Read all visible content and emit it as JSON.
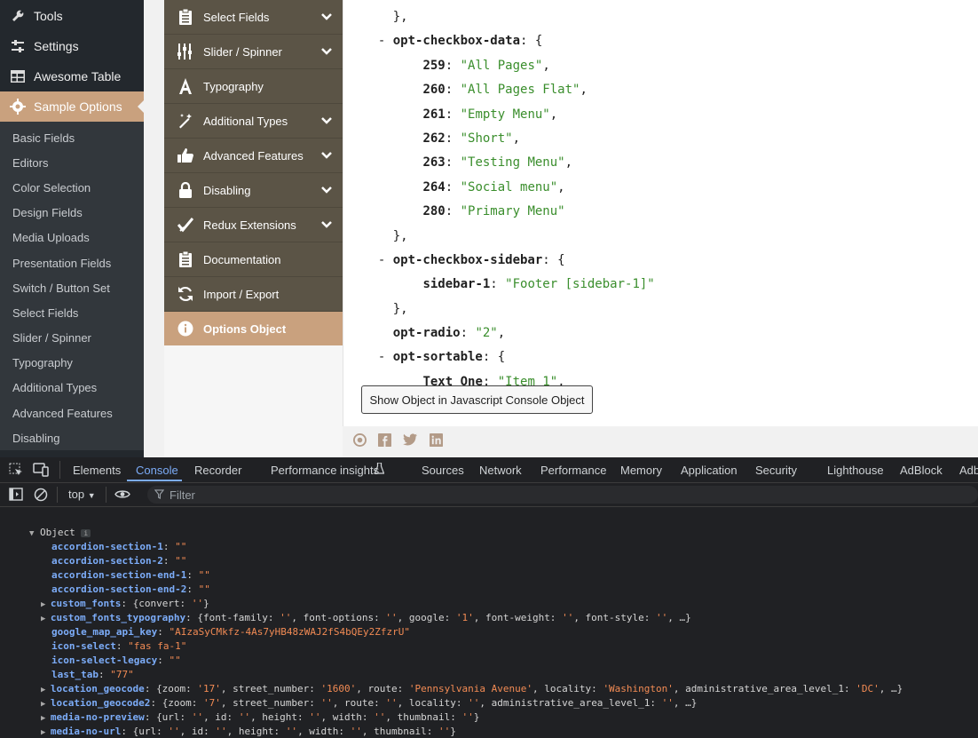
{
  "wp_sidebar": {
    "top_items": [
      {
        "label": "Tools",
        "icon": "wrench-icon"
      },
      {
        "label": "Settings",
        "icon": "sliders-icon"
      },
      {
        "label": "Awesome Table",
        "icon": "table-icon"
      },
      {
        "label": "Sample Options",
        "icon": "gear-icon"
      }
    ],
    "sub_items": [
      "Basic Fields",
      "Editors",
      "Color Selection",
      "Design Fields",
      "Media Uploads",
      "Presentation Fields",
      "Switch / Button Set",
      "Select Fields",
      "Slider / Spinner",
      "Typography",
      "Additional Types",
      "Advanced Features",
      "Disabling"
    ]
  },
  "redux_nav": {
    "items": [
      {
        "label": "Select Fields",
        "icon": "clipboard-icon",
        "chevron": true
      },
      {
        "label": "Slider / Spinner",
        "icon": "sliders-icon",
        "chevron": true
      },
      {
        "label": "Typography",
        "icon": "font-icon",
        "chevron": false
      },
      {
        "label": "Additional Types",
        "icon": "magic-icon",
        "chevron": true
      },
      {
        "label": "Advanced Features",
        "icon": "thumbs-up-icon",
        "chevron": true
      },
      {
        "label": "Disabling",
        "icon": "lock-icon",
        "chevron": true
      },
      {
        "label": "Redux Extensions",
        "icon": "check-icon",
        "chevron": true
      },
      {
        "label": "Documentation",
        "icon": "clipboard-icon",
        "chevron": false
      },
      {
        "label": "Import / Export",
        "icon": "refresh-icon",
        "chevron": false
      }
    ],
    "active": {
      "label": "Options Object",
      "icon": "info-icon"
    }
  },
  "code_lines": [
    {
      "t": [
        "    ",
        "}",
        ","
      ]
    },
    {
      "t": [
        "  - ",
        "opt-checkbox-data",
        ": {"
      ],
      "kind": "key"
    },
    {
      "t": [
        "        ",
        "259",
        ": ",
        "\"All Pages\"",
        ","
      ],
      "kind": "entry"
    },
    {
      "t": [
        "        ",
        "260",
        ": ",
        "\"All Pages Flat\"",
        ","
      ],
      "kind": "entry"
    },
    {
      "t": [
        "        ",
        "261",
        ": ",
        "\"Empty Menu\"",
        ","
      ],
      "kind": "entry"
    },
    {
      "t": [
        "        ",
        "262",
        ": ",
        "\"Short\"",
        ","
      ],
      "kind": "entry"
    },
    {
      "t": [
        "        ",
        "263",
        ": ",
        "\"Testing Menu\"",
        ","
      ],
      "kind": "entry"
    },
    {
      "t": [
        "        ",
        "264",
        ": ",
        "\"Social menu\"",
        ","
      ],
      "kind": "entry"
    },
    {
      "t": [
        "        ",
        "280",
        ": ",
        "\"Primary Menu\"",
        ""
      ],
      "kind": "entry"
    },
    {
      "t": [
        "    ",
        "}",
        ","
      ]
    },
    {
      "t": [
        "  - ",
        "opt-checkbox-sidebar",
        ": {"
      ],
      "kind": "key"
    },
    {
      "t": [
        "        ",
        "sidebar-1",
        ": ",
        "\"Footer [sidebar-1]\"",
        ""
      ],
      "kind": "entry"
    },
    {
      "t": [
        "    ",
        "}",
        ","
      ]
    },
    {
      "t": [
        "    ",
        "opt-radio",
        ": ",
        "\"2\"",
        ","
      ],
      "kind": "entry"
    },
    {
      "t": [
        "  - ",
        "opt-sortable",
        ": {"
      ],
      "kind": "key"
    },
    {
      "t": [
        "        ",
        "Text One",
        ": ",
        "\"Item 1\"",
        ","
      ],
      "kind": "entry"
    }
  ],
  "show_button": "Show Object in Javascript Console Object",
  "footer_icons": [
    "redux-icon",
    "facebook-icon",
    "twitter-icon",
    "linkedin-icon"
  ],
  "devtools": {
    "tabs": [
      "Elements",
      "Console",
      "Recorder",
      "Performance insights",
      "Sources",
      "Network",
      "Performance",
      "Memory",
      "Application",
      "Security",
      "Lighthouse",
      "AdBlock",
      "Adb"
    ],
    "active_tab": "Console",
    "context": "top",
    "filter_placeholder": "Filter",
    "object_label": "Object",
    "object_info": "i",
    "entries": [
      {
        "key": "accordion-section-1",
        "value": "\"\"",
        "expandable": false
      },
      {
        "key": "accordion-section-2",
        "value": "\"\"",
        "expandable": false
      },
      {
        "key": "accordion-section-end-1",
        "value": "\"\"",
        "expandable": false
      },
      {
        "key": "accordion-section-end-2",
        "value": "\"\"",
        "expandable": false
      },
      {
        "key": "custom_fonts",
        "value": "{convert: ''}",
        "expandable": true
      },
      {
        "key": "custom_fonts_typography",
        "value": "{font-family: '', font-options: '', google: '1', font-weight: '', font-style: '', …}",
        "expandable": true
      },
      {
        "key": "google_map_api_key",
        "value": "\"AIzaSyCMkfz-4As7yHB48zWAJ2fS4bQEy2ZfzrU\"",
        "expandable": false
      },
      {
        "key": "icon-select",
        "value": "\"fas fa-1\"",
        "expandable": false
      },
      {
        "key": "icon-select-legacy",
        "value": "\"\"",
        "expandable": false
      },
      {
        "key": "last_tab",
        "value": "\"77\"",
        "expandable": false
      },
      {
        "key": "location_geocode",
        "value": "{zoom: '17', street_number: '1600', route: 'Pennsylvania Avenue', locality: 'Washington', administrative_area_level_1: 'DC', …}",
        "expandable": true
      },
      {
        "key": "location_geocode2",
        "value": "{zoom: '7', street_number: '', route: '', locality: '', administrative_area_level_1: '', …}",
        "expandable": true
      },
      {
        "key": "media-no-preview",
        "value": "{url: '', id: '', height: '', width: '', thumbnail: ''}",
        "expandable": true
      },
      {
        "key": "media-no-url",
        "value": "{url: '', id: '', height: '', width: '', thumbnail: ''}",
        "expandable": true
      }
    ]
  }
}
